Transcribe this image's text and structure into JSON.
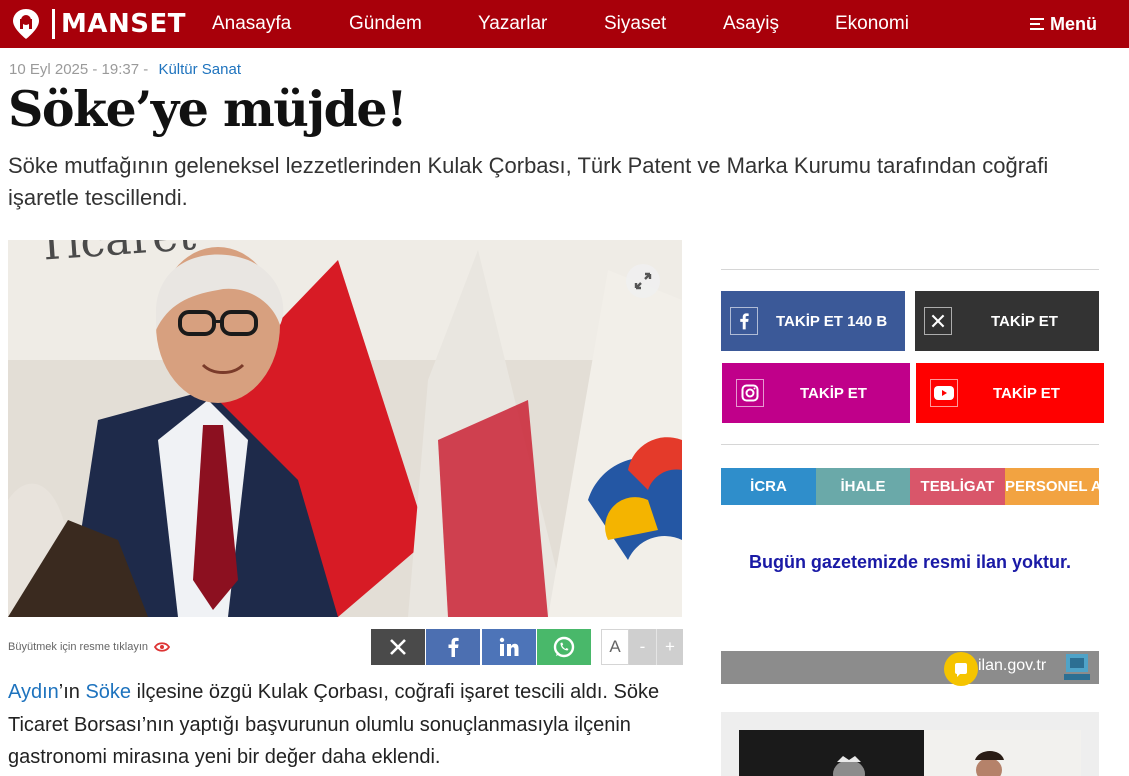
{
  "header": {
    "logo_text": "MANSET",
    "nav": [
      "Anasayfa",
      "Gündem",
      "Yazarlar",
      "Siyaset",
      "Asayiş",
      "Ekonomi"
    ],
    "menu_label": "Menü"
  },
  "article": {
    "date": "10 Eyl 2025 - 19:37",
    "separator": "-",
    "category": "Kültür Sanat",
    "title": "Söke’ye müjde!",
    "summary": "Söke mutfağının geleneksel lezzetlerinden Kulak Çorbası, Türk Patent ve Marka Kurumu tarafından coğrafi işaretle tescillendi.",
    "enlarge_hint": "Büyütmek için resme tıklayın",
    "font_controls": {
      "a": "A",
      "minus": "-",
      "plus": "+"
    },
    "body": {
      "link1": "Aydın",
      "t1": "’ın ",
      "link2": "Söke",
      "t2": " ilçesine özgü Kulak Çorbası, coğrafi işaret tescili aldı. Söke Ticaret Borsası’nın yaptığı başvurunun olumlu sonuçlanmasıyla ilçenin gastronomi mirasına yeni bir değer daha eklendi."
    }
  },
  "sidebar": {
    "social": [
      {
        "icon": "facebook-icon",
        "label": "TAKİP ET 140 B",
        "color": "#3b5998"
      },
      {
        "icon": "x-icon",
        "label": "TAKİP ET",
        "color": "#333333"
      },
      {
        "icon": "instagram-icon",
        "label": "TAKİP ET",
        "color": "#c0008a"
      },
      {
        "icon": "youtube-icon",
        "label": "TAKİP ET",
        "color": "#ff0000"
      }
    ],
    "tabs": [
      {
        "label": "İCRA",
        "color": "#2f8ecb"
      },
      {
        "label": "İHALE",
        "color": "#6aa9a9"
      },
      {
        "label": "TEBLİGAT",
        "color": "#d9566a"
      },
      {
        "label": "PERSONEL ALIMI",
        "color": "#f2a341"
      }
    ],
    "notice": "Bugün gazetemizde resmi ilan yoktur.",
    "ilan_text": "ilan.gov.tr"
  },
  "colors": {
    "brand": "#a8000a",
    "link": "#1e73be",
    "share_x": "#4a4a4a",
    "share_facebook": "#4c6fb1",
    "share_linkedin": "#4d74b8",
    "share_whatsapp": "#49b86a"
  }
}
